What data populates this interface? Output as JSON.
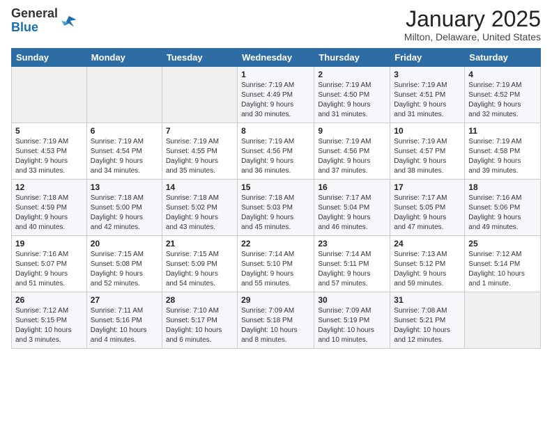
{
  "logo": {
    "general": "General",
    "blue": "Blue"
  },
  "title": "January 2025",
  "location": "Milton, Delaware, United States",
  "weekdays": [
    "Sunday",
    "Monday",
    "Tuesday",
    "Wednesday",
    "Thursday",
    "Friday",
    "Saturday"
  ],
  "weeks": [
    [
      {
        "day": "",
        "info": ""
      },
      {
        "day": "",
        "info": ""
      },
      {
        "day": "",
        "info": ""
      },
      {
        "day": "1",
        "info": "Sunrise: 7:19 AM\nSunset: 4:49 PM\nDaylight: 9 hours\nand 30 minutes."
      },
      {
        "day": "2",
        "info": "Sunrise: 7:19 AM\nSunset: 4:50 PM\nDaylight: 9 hours\nand 31 minutes."
      },
      {
        "day": "3",
        "info": "Sunrise: 7:19 AM\nSunset: 4:51 PM\nDaylight: 9 hours\nand 31 minutes."
      },
      {
        "day": "4",
        "info": "Sunrise: 7:19 AM\nSunset: 4:52 PM\nDaylight: 9 hours\nand 32 minutes."
      }
    ],
    [
      {
        "day": "5",
        "info": "Sunrise: 7:19 AM\nSunset: 4:53 PM\nDaylight: 9 hours\nand 33 minutes."
      },
      {
        "day": "6",
        "info": "Sunrise: 7:19 AM\nSunset: 4:54 PM\nDaylight: 9 hours\nand 34 minutes."
      },
      {
        "day": "7",
        "info": "Sunrise: 7:19 AM\nSunset: 4:55 PM\nDaylight: 9 hours\nand 35 minutes."
      },
      {
        "day": "8",
        "info": "Sunrise: 7:19 AM\nSunset: 4:56 PM\nDaylight: 9 hours\nand 36 minutes."
      },
      {
        "day": "9",
        "info": "Sunrise: 7:19 AM\nSunset: 4:56 PM\nDaylight: 9 hours\nand 37 minutes."
      },
      {
        "day": "10",
        "info": "Sunrise: 7:19 AM\nSunset: 4:57 PM\nDaylight: 9 hours\nand 38 minutes."
      },
      {
        "day": "11",
        "info": "Sunrise: 7:19 AM\nSunset: 4:58 PM\nDaylight: 9 hours\nand 39 minutes."
      }
    ],
    [
      {
        "day": "12",
        "info": "Sunrise: 7:18 AM\nSunset: 4:59 PM\nDaylight: 9 hours\nand 40 minutes."
      },
      {
        "day": "13",
        "info": "Sunrise: 7:18 AM\nSunset: 5:00 PM\nDaylight: 9 hours\nand 42 minutes."
      },
      {
        "day": "14",
        "info": "Sunrise: 7:18 AM\nSunset: 5:02 PM\nDaylight: 9 hours\nand 43 minutes."
      },
      {
        "day": "15",
        "info": "Sunrise: 7:18 AM\nSunset: 5:03 PM\nDaylight: 9 hours\nand 45 minutes."
      },
      {
        "day": "16",
        "info": "Sunrise: 7:17 AM\nSunset: 5:04 PM\nDaylight: 9 hours\nand 46 minutes."
      },
      {
        "day": "17",
        "info": "Sunrise: 7:17 AM\nSunset: 5:05 PM\nDaylight: 9 hours\nand 47 minutes."
      },
      {
        "day": "18",
        "info": "Sunrise: 7:16 AM\nSunset: 5:06 PM\nDaylight: 9 hours\nand 49 minutes."
      }
    ],
    [
      {
        "day": "19",
        "info": "Sunrise: 7:16 AM\nSunset: 5:07 PM\nDaylight: 9 hours\nand 51 minutes."
      },
      {
        "day": "20",
        "info": "Sunrise: 7:15 AM\nSunset: 5:08 PM\nDaylight: 9 hours\nand 52 minutes."
      },
      {
        "day": "21",
        "info": "Sunrise: 7:15 AM\nSunset: 5:09 PM\nDaylight: 9 hours\nand 54 minutes."
      },
      {
        "day": "22",
        "info": "Sunrise: 7:14 AM\nSunset: 5:10 PM\nDaylight: 9 hours\nand 55 minutes."
      },
      {
        "day": "23",
        "info": "Sunrise: 7:14 AM\nSunset: 5:11 PM\nDaylight: 9 hours\nand 57 minutes."
      },
      {
        "day": "24",
        "info": "Sunrise: 7:13 AM\nSunset: 5:12 PM\nDaylight: 9 hours\nand 59 minutes."
      },
      {
        "day": "25",
        "info": "Sunrise: 7:12 AM\nSunset: 5:14 PM\nDaylight: 10 hours\nand 1 minute."
      }
    ],
    [
      {
        "day": "26",
        "info": "Sunrise: 7:12 AM\nSunset: 5:15 PM\nDaylight: 10 hours\nand 3 minutes."
      },
      {
        "day": "27",
        "info": "Sunrise: 7:11 AM\nSunset: 5:16 PM\nDaylight: 10 hours\nand 4 minutes."
      },
      {
        "day": "28",
        "info": "Sunrise: 7:10 AM\nSunset: 5:17 PM\nDaylight: 10 hours\nand 6 minutes."
      },
      {
        "day": "29",
        "info": "Sunrise: 7:09 AM\nSunset: 5:18 PM\nDaylight: 10 hours\nand 8 minutes."
      },
      {
        "day": "30",
        "info": "Sunrise: 7:09 AM\nSunset: 5:19 PM\nDaylight: 10 hours\nand 10 minutes."
      },
      {
        "day": "31",
        "info": "Sunrise: 7:08 AM\nSunset: 5:21 PM\nDaylight: 10 hours\nand 12 minutes."
      },
      {
        "day": "",
        "info": ""
      }
    ]
  ]
}
